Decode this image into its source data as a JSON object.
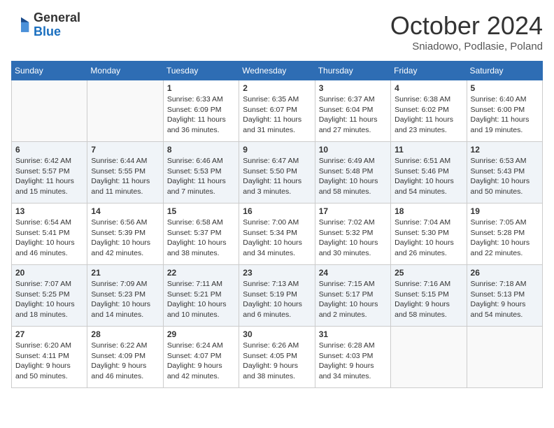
{
  "header": {
    "logo_general": "General",
    "logo_blue": "Blue",
    "month_title": "October 2024",
    "location": "Sniadowo, Podlasie, Poland"
  },
  "weekdays": [
    "Sunday",
    "Monday",
    "Tuesday",
    "Wednesday",
    "Thursday",
    "Friday",
    "Saturday"
  ],
  "weeks": [
    [
      {
        "day": "",
        "info": ""
      },
      {
        "day": "",
        "info": ""
      },
      {
        "day": "1",
        "info": "Sunrise: 6:33 AM\nSunset: 6:09 PM\nDaylight: 11 hours and 36 minutes."
      },
      {
        "day": "2",
        "info": "Sunrise: 6:35 AM\nSunset: 6:07 PM\nDaylight: 11 hours and 31 minutes."
      },
      {
        "day": "3",
        "info": "Sunrise: 6:37 AM\nSunset: 6:04 PM\nDaylight: 11 hours and 27 minutes."
      },
      {
        "day": "4",
        "info": "Sunrise: 6:38 AM\nSunset: 6:02 PM\nDaylight: 11 hours and 23 minutes."
      },
      {
        "day": "5",
        "info": "Sunrise: 6:40 AM\nSunset: 6:00 PM\nDaylight: 11 hours and 19 minutes."
      }
    ],
    [
      {
        "day": "6",
        "info": "Sunrise: 6:42 AM\nSunset: 5:57 PM\nDaylight: 11 hours and 15 minutes."
      },
      {
        "day": "7",
        "info": "Sunrise: 6:44 AM\nSunset: 5:55 PM\nDaylight: 11 hours and 11 minutes."
      },
      {
        "day": "8",
        "info": "Sunrise: 6:46 AM\nSunset: 5:53 PM\nDaylight: 11 hours and 7 minutes."
      },
      {
        "day": "9",
        "info": "Sunrise: 6:47 AM\nSunset: 5:50 PM\nDaylight: 11 hours and 3 minutes."
      },
      {
        "day": "10",
        "info": "Sunrise: 6:49 AM\nSunset: 5:48 PM\nDaylight: 10 hours and 58 minutes."
      },
      {
        "day": "11",
        "info": "Sunrise: 6:51 AM\nSunset: 5:46 PM\nDaylight: 10 hours and 54 minutes."
      },
      {
        "day": "12",
        "info": "Sunrise: 6:53 AM\nSunset: 5:43 PM\nDaylight: 10 hours and 50 minutes."
      }
    ],
    [
      {
        "day": "13",
        "info": "Sunrise: 6:54 AM\nSunset: 5:41 PM\nDaylight: 10 hours and 46 minutes."
      },
      {
        "day": "14",
        "info": "Sunrise: 6:56 AM\nSunset: 5:39 PM\nDaylight: 10 hours and 42 minutes."
      },
      {
        "day": "15",
        "info": "Sunrise: 6:58 AM\nSunset: 5:37 PM\nDaylight: 10 hours and 38 minutes."
      },
      {
        "day": "16",
        "info": "Sunrise: 7:00 AM\nSunset: 5:34 PM\nDaylight: 10 hours and 34 minutes."
      },
      {
        "day": "17",
        "info": "Sunrise: 7:02 AM\nSunset: 5:32 PM\nDaylight: 10 hours and 30 minutes."
      },
      {
        "day": "18",
        "info": "Sunrise: 7:04 AM\nSunset: 5:30 PM\nDaylight: 10 hours and 26 minutes."
      },
      {
        "day": "19",
        "info": "Sunrise: 7:05 AM\nSunset: 5:28 PM\nDaylight: 10 hours and 22 minutes."
      }
    ],
    [
      {
        "day": "20",
        "info": "Sunrise: 7:07 AM\nSunset: 5:25 PM\nDaylight: 10 hours and 18 minutes."
      },
      {
        "day": "21",
        "info": "Sunrise: 7:09 AM\nSunset: 5:23 PM\nDaylight: 10 hours and 14 minutes."
      },
      {
        "day": "22",
        "info": "Sunrise: 7:11 AM\nSunset: 5:21 PM\nDaylight: 10 hours and 10 minutes."
      },
      {
        "day": "23",
        "info": "Sunrise: 7:13 AM\nSunset: 5:19 PM\nDaylight: 10 hours and 6 minutes."
      },
      {
        "day": "24",
        "info": "Sunrise: 7:15 AM\nSunset: 5:17 PM\nDaylight: 10 hours and 2 minutes."
      },
      {
        "day": "25",
        "info": "Sunrise: 7:16 AM\nSunset: 5:15 PM\nDaylight: 9 hours and 58 minutes."
      },
      {
        "day": "26",
        "info": "Sunrise: 7:18 AM\nSunset: 5:13 PM\nDaylight: 9 hours and 54 minutes."
      }
    ],
    [
      {
        "day": "27",
        "info": "Sunrise: 6:20 AM\nSunset: 4:11 PM\nDaylight: 9 hours and 50 minutes."
      },
      {
        "day": "28",
        "info": "Sunrise: 6:22 AM\nSunset: 4:09 PM\nDaylight: 9 hours and 46 minutes."
      },
      {
        "day": "29",
        "info": "Sunrise: 6:24 AM\nSunset: 4:07 PM\nDaylight: 9 hours and 42 minutes."
      },
      {
        "day": "30",
        "info": "Sunrise: 6:26 AM\nSunset: 4:05 PM\nDaylight: 9 hours and 38 minutes."
      },
      {
        "day": "31",
        "info": "Sunrise: 6:28 AM\nSunset: 4:03 PM\nDaylight: 9 hours and 34 minutes."
      },
      {
        "day": "",
        "info": ""
      },
      {
        "day": "",
        "info": ""
      }
    ]
  ]
}
